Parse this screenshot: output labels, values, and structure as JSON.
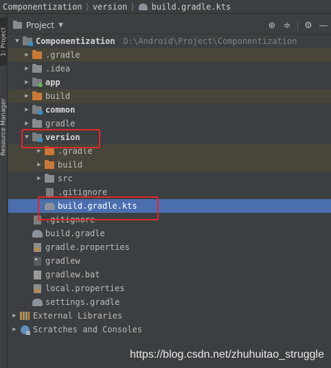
{
  "breadcrumb": [
    {
      "label": "Componentization",
      "icon": "folder-icon"
    },
    {
      "label": "version",
      "icon": "folder-icon"
    },
    {
      "label": "build.gradle.kts",
      "icon": "gradle-kts-icon"
    }
  ],
  "left_stripe": {
    "tabs": [
      {
        "label": "1: Project"
      },
      {
        "label": "Resource Manager"
      }
    ]
  },
  "tool_window": {
    "title": "Project",
    "dropdown_caret": "▼",
    "tools": {
      "locate": "⊕",
      "collapse": "≑",
      "settings": "⚙",
      "hide": "—"
    }
  },
  "tree": {
    "root": {
      "label": "Componentization",
      "path": "D:\\Android\\Project\\Componentization"
    },
    "rows": [
      {
        "label": ".gradle"
      },
      {
        "label": ".idea"
      },
      {
        "label": "app"
      },
      {
        "label": "build"
      },
      {
        "label": "common"
      },
      {
        "label": "gradle"
      },
      {
        "label": "version"
      },
      {
        "label": ".gradle"
      },
      {
        "label": "build"
      },
      {
        "label": "src"
      },
      {
        "label": ".gitignore"
      },
      {
        "label": "build.gradle.kts"
      },
      {
        "label": ".gitignore"
      },
      {
        "label": "build.gradle"
      },
      {
        "label": "gradle.properties"
      },
      {
        "label": "gradlew"
      },
      {
        "label": "gradlew.bat"
      },
      {
        "label": "local.properties"
      },
      {
        "label": "settings.gradle"
      }
    ],
    "external_libraries": "External Libraries",
    "scratches": "Scratches and Consoles"
  },
  "colors": {
    "background": "#3c3f41",
    "selection": "#4b6eaf",
    "excluded_row": "#48453a",
    "annotation": "#e2262b"
  },
  "watermark": "https://blog.csdn.net/zhuhuitao_struggle"
}
